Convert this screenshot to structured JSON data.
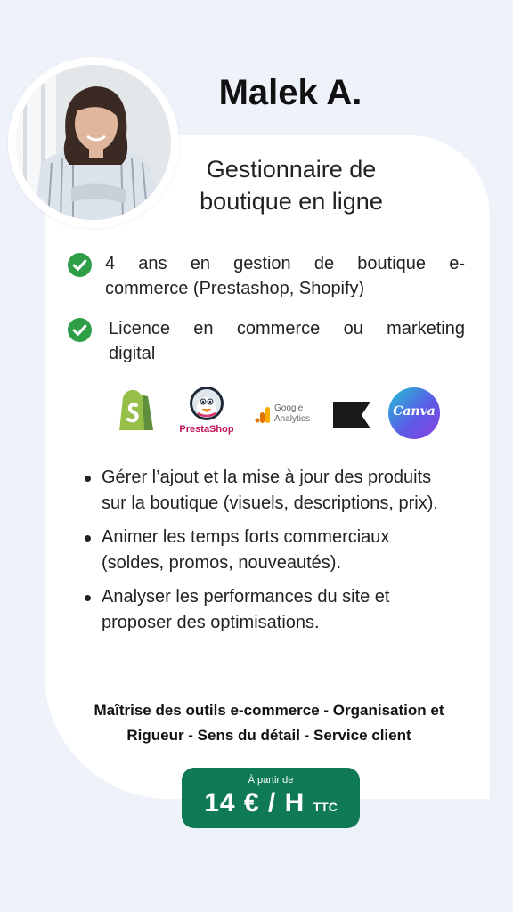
{
  "profile": {
    "name": "Malek A.",
    "role": "Gestionnaire de boutique en ligne"
  },
  "qualifications": [
    {
      "line1": "4 ans en gestion de boutique e-",
      "line2": "commerce (Prestashop, Shopify)"
    },
    {
      "line1": "Licence en commerce ou marketing",
      "line2": "digital"
    }
  ],
  "tools": {
    "prestashop": "PrestaShop",
    "google_analytics_1": "Google",
    "google_analytics_2": "Analytics",
    "canva": "Canva"
  },
  "tasks": [
    "Gérer l’ajout et la mise à jour des produits sur la boutique (visuels, descriptions, prix).",
    "Animer les temps forts commerciaux (soldes, promos, nouveautés).",
    "Analyser les performances du site et proposer des optimisations."
  ],
  "skills": {
    "line1": "Maîtrise des outils e-commerce - Organisation et",
    "line2": "Rigueur - Sens du détail - Service client"
  },
  "price": {
    "from_label": "À partir de",
    "value": "14 € / H",
    "suffix": "TTC"
  },
  "colors": {
    "background": "#eef3fa",
    "check_green": "#2e9e47",
    "price_green": "#0f7a53"
  }
}
